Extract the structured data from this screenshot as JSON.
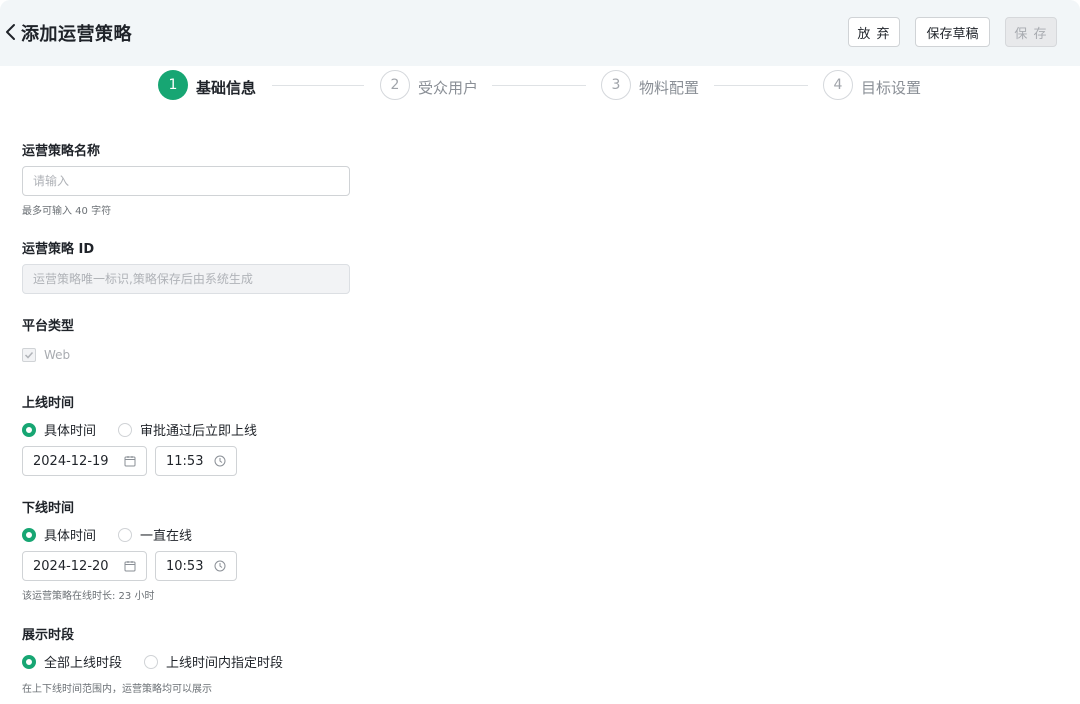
{
  "header": {
    "title": "添加运营策略",
    "discard_label": "放 弃",
    "draft_label": "保存草稿",
    "save_label": "保 存"
  },
  "steps": [
    {
      "number": "1",
      "label": "基础信息",
      "state": "active"
    },
    {
      "number": "2",
      "label": "受众用户",
      "state": "todo"
    },
    {
      "number": "3",
      "label": "物料配置",
      "state": "todo"
    },
    {
      "number": "4",
      "label": "目标设置",
      "state": "todo"
    }
  ],
  "form": {
    "name": {
      "label": "运营策略名称",
      "placeholder": "请输入",
      "help": "最多可输入 40 字符"
    },
    "id": {
      "label": "运营策略 ID",
      "placeholder": "运营策略唯一标识,策略保存后由系统生成"
    },
    "platform": {
      "label": "平台类型",
      "option": "Web"
    },
    "online": {
      "label": "上线时间",
      "options": [
        "具体时间",
        "审批通过后立即上线"
      ],
      "selected": "具体时间",
      "date": "2024-12-19",
      "time": "11:53"
    },
    "offline": {
      "label": "下线时间",
      "options": [
        "具体时间",
        "一直在线"
      ],
      "selected": "具体时间",
      "date": "2024-12-20",
      "time": "10:53",
      "help": "该运营策略在线时长: 23 小时"
    },
    "display": {
      "label": "展示时段",
      "options": [
        "全部上线时段",
        "上线时间内指定时段"
      ],
      "selected": "全部上线时段",
      "help": "在上下线时间范围内，运营策略均可以展示"
    }
  },
  "colors": {
    "accent": "#17a673",
    "header_bg": "#f2f6f8"
  },
  "icons": [
    "chevron-left-icon",
    "check-icon",
    "calendar-icon",
    "clock-icon"
  ]
}
